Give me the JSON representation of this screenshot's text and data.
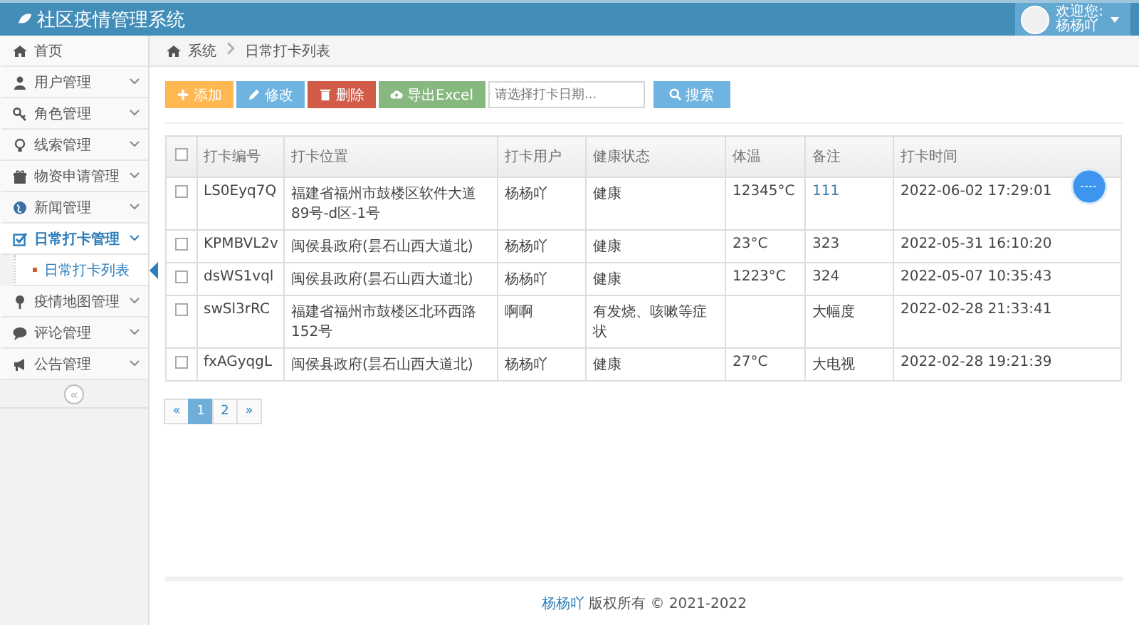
{
  "header": {
    "title": "社区疫情管理系统",
    "user": {
      "greeting": "欢迎您:",
      "name": "杨杨吖"
    }
  },
  "sidebar": {
    "items": [
      {
        "kind": "link",
        "label": "首页",
        "selected": false
      },
      {
        "kind": "menu",
        "label": "用户管理",
        "expanded": false,
        "selected": false
      },
      {
        "kind": "menu",
        "label": "角色管理",
        "expanded": false,
        "selected": false
      },
      {
        "kind": "menu",
        "label": "线索管理",
        "expanded": false,
        "selected": false
      },
      {
        "kind": "menu",
        "label": "物资申请管理",
        "expanded": false,
        "selected": false
      },
      {
        "kind": "menu",
        "label": "新闻管理",
        "expanded": false,
        "selected": false
      },
      {
        "kind": "menu",
        "label": "日常打卡管理",
        "expanded": true,
        "selected": true,
        "children": [
          {
            "label": "日常打卡列表",
            "selected": true
          }
        ]
      },
      {
        "kind": "menu",
        "label": "疫情地图管理",
        "expanded": false,
        "selected": false
      },
      {
        "kind": "menu",
        "label": "评论管理",
        "expanded": false,
        "selected": false
      },
      {
        "kind": "menu",
        "label": "公告管理",
        "expanded": false,
        "selected": false
      }
    ],
    "collapse": "«"
  },
  "breadcrumb": [
    "系统",
    "日常打卡列表"
  ],
  "toolbar": {
    "buttons": [
      {
        "kind": "add",
        "label": "添加"
      },
      {
        "kind": "edit",
        "label": "修改"
      },
      {
        "kind": "delete",
        "label": "删除"
      },
      {
        "kind": "export",
        "label": "导出Excel"
      }
    ],
    "date_field": {
      "placeholder": "请选择打卡日期..."
    },
    "search": {
      "kind": "search",
      "label": "搜索"
    }
  },
  "table": {
    "columns": [
      "打卡编号",
      "打卡位置",
      "打卡用户",
      "健康状态",
      "体温",
      "备注",
      "打卡时间"
    ],
    "header_checked": false,
    "rows": [
      {
        "checked": false,
        "cells": [
          "LS0Eyq7Q",
          "福建省福州市鼓楼区软件大道89号-d区-1号",
          "杨杨吖",
          "健康",
          "12345°C",
          "111",
          "2022-06-02 17:29:01"
        ]
      },
      {
        "checked": false,
        "cells": [
          "KPMBVL2v",
          "闽侯县政府(昙石山西大道北)",
          "杨杨吖",
          "健康",
          "23°C",
          "323",
          "2022-05-31 16:10:20"
        ]
      },
      {
        "checked": false,
        "cells": [
          "dsWS1vql",
          "闽侯县政府(昙石山西大道北)",
          "杨杨吖",
          "健康",
          "1223°C",
          "324",
          "2022-05-07 10:35:43"
        ]
      },
      {
        "checked": false,
        "cells": [
          "swSl3rRC",
          "福建省福州市鼓楼区北环西路152号",
          "啊啊",
          "有发烧、咳嗽等症状",
          "",
          "大幅度",
          "2022-02-28 21:33:41"
        ]
      },
      {
        "checked": false,
        "cells": [
          "fxAGyqgL",
          "闽侯县政府(昙石山西大道北)",
          "杨杨吖",
          "健康",
          "27°C",
          "大电视",
          "2022-02-28 19:21:39"
        ]
      }
    ]
  },
  "pagination": [
    {
      "label": "«",
      "selected": false
    },
    {
      "label": "1",
      "selected": true
    },
    {
      "label": "2",
      "selected": false
    },
    {
      "label": "»",
      "selected": false
    }
  ],
  "footer": {
    "author": "杨杨吖",
    "text": "版权所有 © 2021-2022"
  }
}
